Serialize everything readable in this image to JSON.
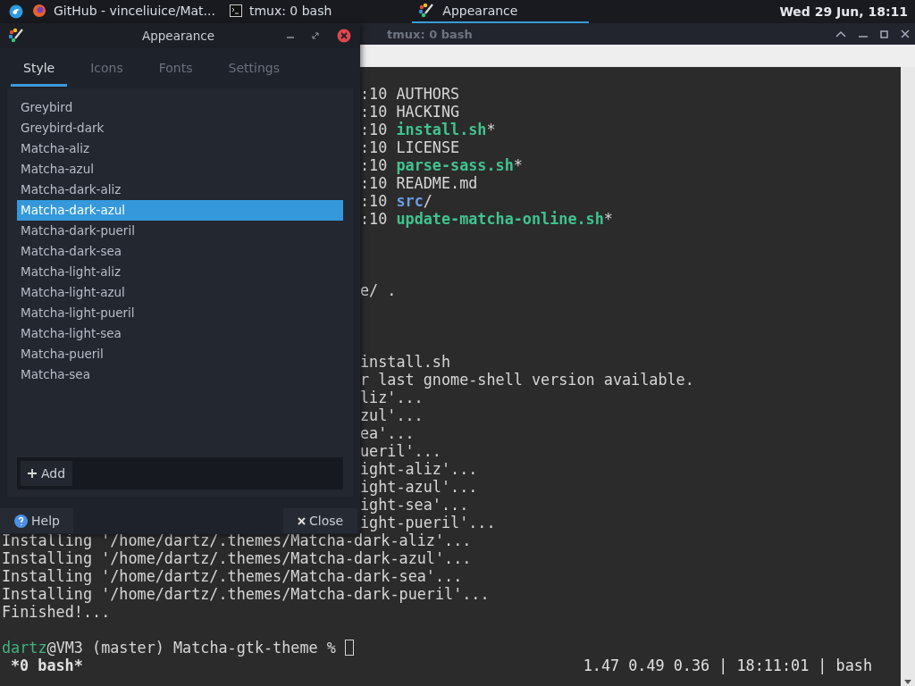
{
  "top_panel": {
    "tasks": [
      {
        "label": "GitHub - vinceliuice/Mat...",
        "kind": "browser",
        "selected": false
      },
      {
        "label": "tmux: 0 bash",
        "kind": "terminal",
        "selected": false
      },
      {
        "label": "Appearance",
        "kind": "appearance",
        "selected": true
      }
    ],
    "clock": "Wed 29 Jun, 18:11"
  },
  "terminal_window": {
    "title": "tmux: 0 bash",
    "covered_lines": [
      {
        "kind": "text",
        "segments": [
          {
            "text": ":10 AUTHORS",
            "kind": "plain"
          }
        ]
      },
      {
        "kind": "text",
        "segments": [
          {
            "text": ":10 HACKING",
            "kind": "plain"
          }
        ]
      },
      {
        "kind": "text",
        "segments": [
          {
            "text": ":10 ",
            "kind": "plain"
          },
          {
            "text": "install.sh",
            "kind": "exec"
          },
          {
            "text": "*",
            "kind": "plain"
          }
        ]
      },
      {
        "kind": "text",
        "segments": [
          {
            "text": ":10 LICENSE",
            "kind": "plain"
          }
        ]
      },
      {
        "kind": "text",
        "segments": [
          {
            "text": ":10 ",
            "kind": "plain"
          },
          {
            "text": "parse-sass.sh",
            "kind": "exec"
          },
          {
            "text": "*",
            "kind": "plain"
          }
        ]
      },
      {
        "kind": "text",
        "segments": [
          {
            "text": ":10 README.md",
            "kind": "plain"
          }
        ]
      },
      {
        "kind": "text",
        "segments": [
          {
            "text": ":10 ",
            "kind": "plain"
          },
          {
            "text": "src",
            "kind": "dir"
          },
          {
            "text": "/",
            "kind": "plain"
          }
        ]
      },
      {
        "kind": "text",
        "segments": [
          {
            "text": ":10 ",
            "kind": "plain"
          },
          {
            "text": "update-matcha-online.sh",
            "kind": "exec"
          },
          {
            "text": "*",
            "kind": "plain"
          }
        ]
      },
      {
        "kind": "blank"
      },
      {
        "kind": "blank"
      },
      {
        "kind": "blank"
      },
      {
        "kind": "text",
        "segments": [
          {
            "text": "e/ .",
            "kind": "plain"
          }
        ]
      },
      {
        "kind": "blank"
      },
      {
        "kind": "blank"
      },
      {
        "kind": "blank"
      },
      {
        "kind": "text",
        "segments": [
          {
            "text": "install.sh",
            "kind": "plain"
          }
        ]
      },
      {
        "kind": "text",
        "segments": [
          {
            "text": "r last gnome-shell version available.",
            "kind": "plain"
          }
        ]
      },
      {
        "kind": "text",
        "segments": [
          {
            "text": "liz'...",
            "kind": "plain"
          }
        ]
      },
      {
        "kind": "text",
        "segments": [
          {
            "text": "zul'...",
            "kind": "plain"
          }
        ]
      },
      {
        "kind": "text",
        "segments": [
          {
            "text": "ea'...",
            "kind": "plain"
          }
        ]
      },
      {
        "kind": "text",
        "segments": [
          {
            "text": "ueril'...",
            "kind": "plain"
          }
        ]
      },
      {
        "kind": "text",
        "segments": [
          {
            "text": "ight-aliz'...",
            "kind": "plain"
          }
        ]
      },
      {
        "kind": "text",
        "segments": [
          {
            "text": "ight-azul'...",
            "kind": "plain"
          }
        ]
      },
      {
        "kind": "text",
        "segments": [
          {
            "text": "ight-sea'...",
            "kind": "plain"
          }
        ]
      },
      {
        "kind": "text",
        "segments": [
          {
            "text": "ight-pueril'...",
            "kind": "plain"
          }
        ]
      }
    ],
    "lines": [
      {
        "kind": "text",
        "segments": [
          {
            "text": "Installing '/home/dartz/.themes/Matcha-dark-aliz'...",
            "kind": "plain"
          }
        ]
      },
      {
        "kind": "text",
        "segments": [
          {
            "text": "Installing '/home/dartz/.themes/Matcha-dark-azul'...",
            "kind": "plain"
          }
        ]
      },
      {
        "kind": "text",
        "segments": [
          {
            "text": "Installing '/home/dartz/.themes/Matcha-dark-sea'...",
            "kind": "plain"
          }
        ]
      },
      {
        "kind": "text",
        "segments": [
          {
            "text": "Installing '/home/dartz/.themes/Matcha-dark-pueril'...",
            "kind": "plain"
          }
        ]
      },
      {
        "kind": "text",
        "segments": [
          {
            "text": "Finished!...",
            "kind": "plain"
          }
        ]
      },
      {
        "kind": "blank"
      },
      {
        "kind": "text",
        "cursor": true,
        "segments": [
          {
            "text": "dartz",
            "kind": "user"
          },
          {
            "text": "@VM3 (master) Matcha-gtk-theme % ",
            "kind": "plain"
          }
        ]
      }
    ],
    "status_bar": {
      "left": "*0 bash*",
      "right": "1.47 0.49 0.36 | 18:11:01 | bash"
    }
  },
  "dialog": {
    "title": "Appearance",
    "tabs": [
      {
        "label": "Style",
        "selected": true
      },
      {
        "label": "Icons",
        "selected": false
      },
      {
        "label": "Fonts",
        "selected": false
      },
      {
        "label": "Settings",
        "selected": false
      }
    ],
    "themes": [
      {
        "label": "Greybird",
        "selected": false
      },
      {
        "label": "Greybird-dark",
        "selected": false
      },
      {
        "label": "Matcha-aliz",
        "selected": false
      },
      {
        "label": "Matcha-azul",
        "selected": false
      },
      {
        "label": "Matcha-dark-aliz",
        "selected": false
      },
      {
        "label": "Matcha-dark-azul",
        "selected": true
      },
      {
        "label": "Matcha-dark-pueril",
        "selected": false
      },
      {
        "label": "Matcha-dark-sea",
        "selected": false
      },
      {
        "label": "Matcha-light-aliz",
        "selected": false
      },
      {
        "label": "Matcha-light-azul",
        "selected": false
      },
      {
        "label": "Matcha-light-pueril",
        "selected": false
      },
      {
        "label": "Matcha-light-sea",
        "selected": false
      },
      {
        "label": "Matcha-pueril",
        "selected": false
      },
      {
        "label": "Matcha-sea",
        "selected": false
      }
    ],
    "add_button": "Add",
    "help_button": "Help",
    "close_button": "Close"
  }
}
